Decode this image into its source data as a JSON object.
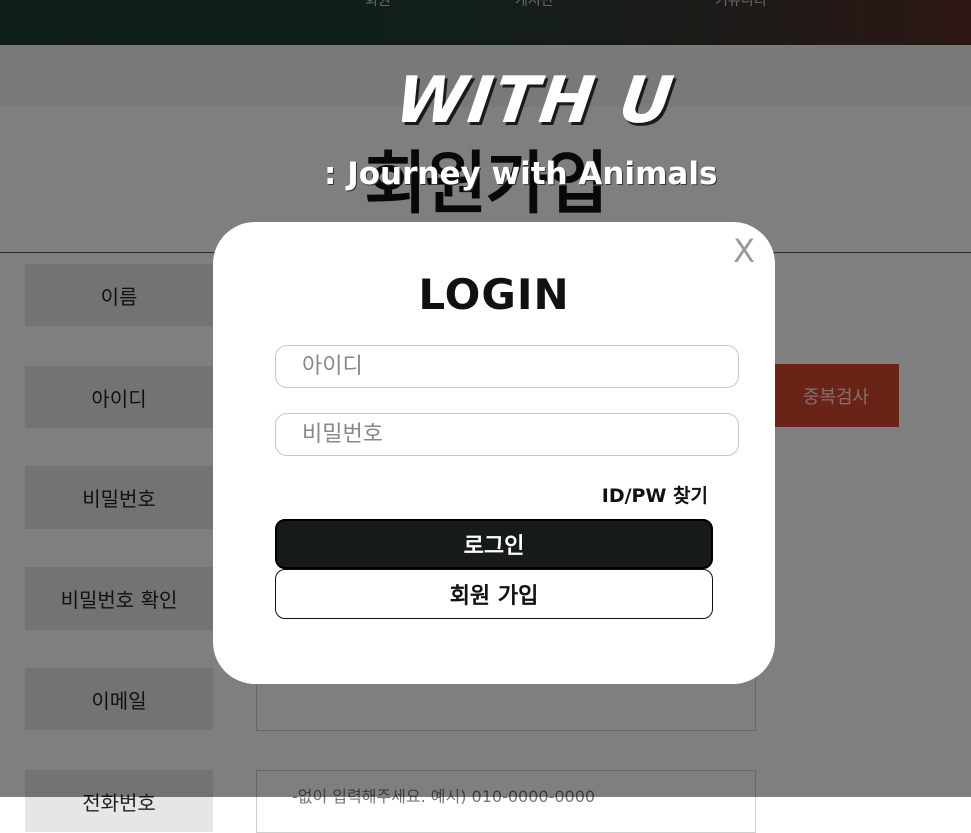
{
  "header": {
    "nav": [
      "회원",
      "게시판",
      "커뮤니티"
    ]
  },
  "page": {
    "title": "회원가입",
    "rows": [
      {
        "label": "이름"
      },
      {
        "label": "아이디"
      },
      {
        "label": "비밀번호"
      },
      {
        "label": "비밀번호 확인"
      },
      {
        "label": "이메일"
      },
      {
        "label": "전화번호"
      }
    ],
    "duplicate_check_label": "중복검사",
    "phone_hint": "-없이 입력해주세요. 예시) 010-0000-0000"
  },
  "logo": {
    "main": "WITH U",
    "sub": ": Journey with Animals"
  },
  "modal": {
    "close": "X",
    "title": "LOGIN",
    "id_placeholder": "아이디",
    "pw_placeholder": "비밀번호",
    "find_link": "ID/PW 찾기",
    "login_button": "로그인",
    "join_button": "회원 가입"
  },
  "colors": {
    "accent": "#d4462f",
    "login_button": "#161a19"
  }
}
